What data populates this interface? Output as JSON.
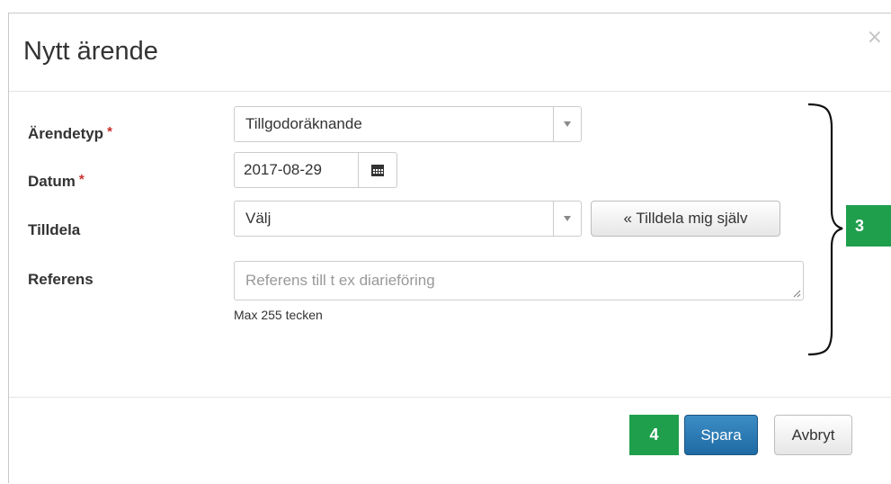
{
  "modal": {
    "title": "Nytt ärende",
    "close_glyph": "×"
  },
  "form": {
    "required_mark": "*",
    "case_type": {
      "label": "Ärendetyp",
      "value": "Tillgodoräknande"
    },
    "date": {
      "label": "Datum",
      "value": "2017-08-29"
    },
    "assign": {
      "label": "Tilldela",
      "value": "Välj",
      "assign_self_label": "« Tilldela mig själv"
    },
    "reference": {
      "label": "Referens",
      "placeholder": "Referens till t ex diarieföring",
      "help": "Max 255 tecken"
    }
  },
  "footer": {
    "save_label": "Spara",
    "cancel_label": "Avbryt"
  },
  "callouts": {
    "form_marker": "3",
    "save_marker": "4"
  },
  "colors": {
    "primary": "#2a7ab7",
    "required": "#c9302c",
    "callout": "#1f9f4c"
  },
  "icons": {
    "close": "close-icon",
    "calendar": "calendar-icon",
    "dropdown": "chevron-down-icon",
    "resize": "resize-grip-icon"
  }
}
